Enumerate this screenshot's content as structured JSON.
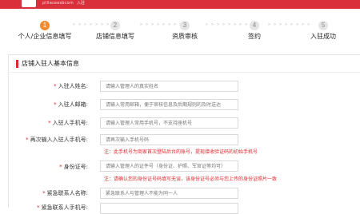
{
  "header": {
    "logo_text": "ptllaceesbcom",
    "logo_sub": "入驻"
  },
  "steps": [
    {
      "number": "1",
      "label": "个人/企业信息填写",
      "active": true
    },
    {
      "number": "2",
      "label": "店铺信息填写",
      "active": false
    },
    {
      "number": "3",
      "label": "资质审核",
      "active": false
    },
    {
      "number": "4",
      "label": "签约",
      "active": false
    },
    {
      "number": "5",
      "label": "入驻成功",
      "active": false
    }
  ],
  "step_arrows": "> > > > > > > >",
  "section": {
    "title": "店铺入驻人基本信息"
  },
  "form": {
    "name": {
      "label": "入驻人姓名:",
      "placeholder": "请输入管理人的真实姓名"
    },
    "email": {
      "label": "入驻人邮箱:",
      "placeholder": "请输入常用邮箱，便于审核信息及后期规则的及时送达"
    },
    "phone": {
      "label": "入驻人手机号:",
      "placeholder": "请输入管理人常用手机号，不支持座机号"
    },
    "phone_confirm": {
      "label": "再次输入入驻人手机号:",
      "placeholder": "请再次输入手机号码"
    },
    "phone_note": "注：此手机号为商家首次登陆后台的账号，提现接收验证码的初始手机号",
    "id_card": {
      "label": "身份证号:",
      "placeholder": "请输入管理人的证件号（身份证、护照、军官证等均可）"
    },
    "id_note": "注：请确认您的身份证号码填写无误，该身份证号必须与您上传的身份证照片一致",
    "emergency_name": {
      "label": "紧急联系人名称:",
      "placeholder": "紧急联系人与管理人不能为同一人"
    },
    "emergency_phone": {
      "label": "紧急联系人手机号:"
    }
  }
}
